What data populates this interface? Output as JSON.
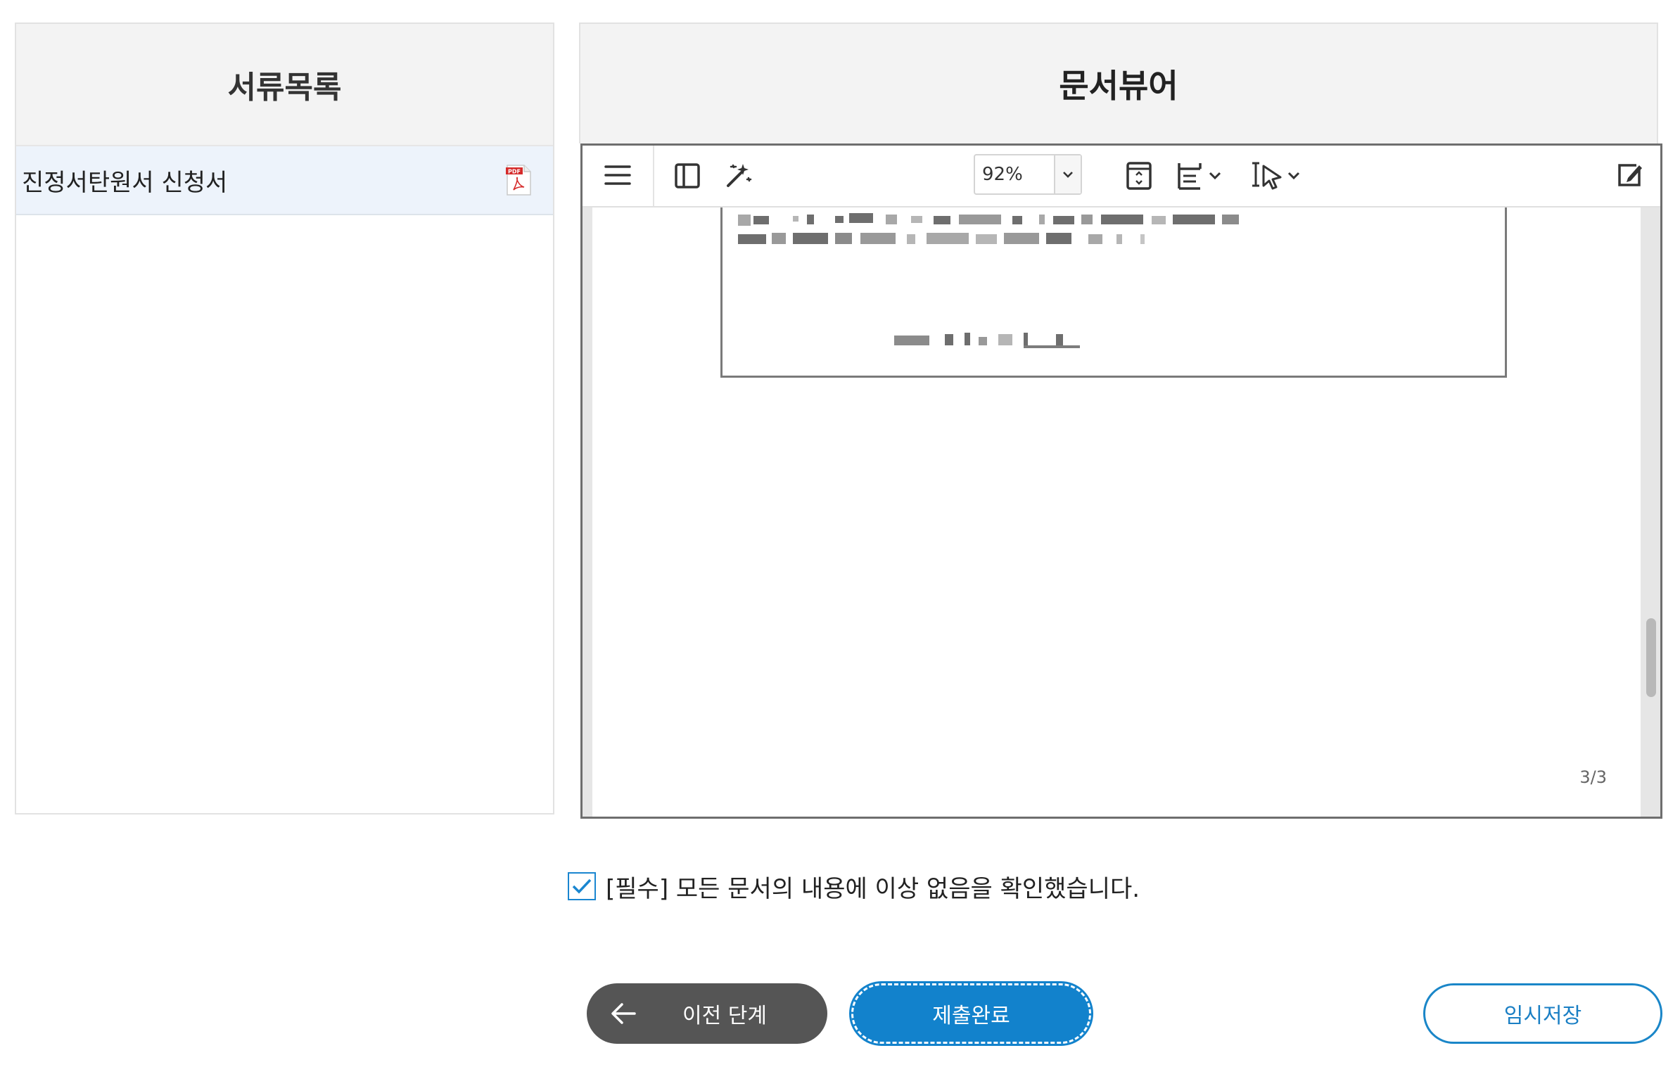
{
  "doc_list": {
    "title": "서류목록",
    "items": [
      {
        "label": "진정서탄원서 신청서",
        "icon": "pdf-file-icon"
      }
    ]
  },
  "viewer": {
    "title": "문서뷰어",
    "toolbar": {
      "menu_icon": "hamburger-menu-icon",
      "sidebar_icon": "sidebar-toggle-icon",
      "magic_icon": "magic-wand-icon",
      "zoom": "92%",
      "fit_icon": "fit-page-icon",
      "layout_icon": "page-layout-icon",
      "select_icon": "text-select-cursor-icon",
      "edit_icon": "edit-annotate-icon"
    },
    "page_indicator": "3/3"
  },
  "confirm": {
    "checked": true,
    "label": "[필수] 모든 문서의 내용에 이상 없음을 확인했습니다."
  },
  "buttons": {
    "prev": "이전 단계",
    "submit": "제출완료",
    "save": "임시저장"
  },
  "colors": {
    "accent": "#1282cc",
    "dark_button": "#555555",
    "list_selected": "#edf3fb",
    "header_bg": "#f3f3f3"
  }
}
